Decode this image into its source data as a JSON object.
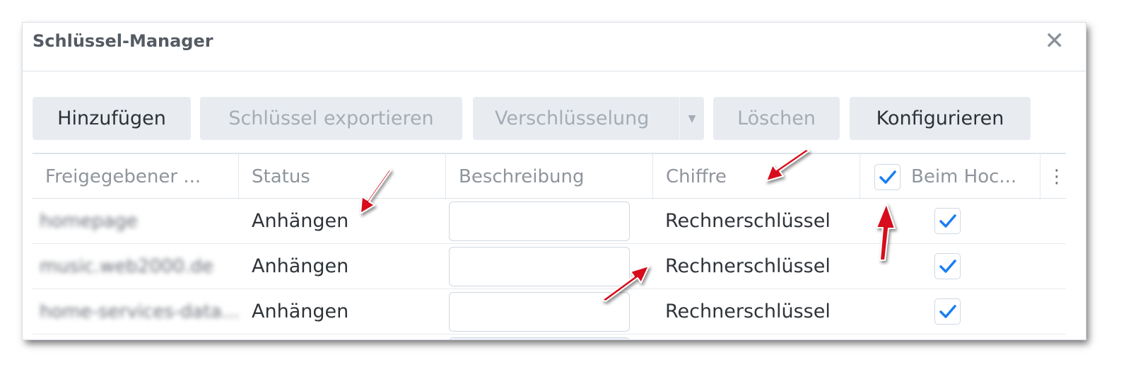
{
  "dialog": {
    "title": "Schlüssel-Manager",
    "close_glyph": "✕"
  },
  "toolbar": {
    "add_label": "Hinzufügen",
    "export_label": "Schlüssel exportieren",
    "encryption_label": "Verschlüsselung",
    "encryption_arrow": "▼",
    "delete_label": "Löschen",
    "configure_label": "Konfigurieren"
  },
  "table": {
    "columns": [
      "Freigegebener ...",
      "Status",
      "Beschreibung",
      "Chiffre",
      "Beim Hoc..."
    ],
    "header_checkbox_checked": true,
    "more_glyph": "⋮",
    "rows": [
      {
        "name": "homepage",
        "status": "Anhängen",
        "description": "",
        "cipher": "Rechnerschlüssel",
        "checked": true
      },
      {
        "name": "music.web2000.de",
        "status": "Anhängen",
        "description": "",
        "cipher": "Rechnerschlüssel",
        "checked": true
      },
      {
        "name": "home-services-data...",
        "status": "Anhängen",
        "description": "",
        "cipher": "Rechnerschlüssel",
        "checked": true
      }
    ]
  },
  "colors": {
    "accent_check": "#1a7ef0",
    "annotation_arrow": "#d7111b",
    "button_bg": "#e8ecf1"
  }
}
